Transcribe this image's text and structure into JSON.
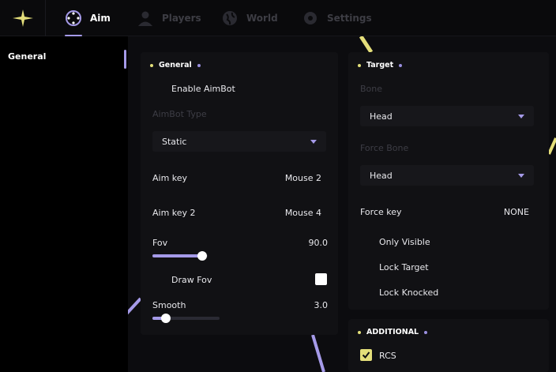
{
  "colors": {
    "accent": "#a59ae8",
    "accent_yellow": "#e4de7a",
    "background": "#0c0c0f",
    "panel": "#111114"
  },
  "nav": {
    "logo_icon": "star-logo-icon",
    "tabs": [
      {
        "label": "Aim",
        "icon": "crosshair-icon",
        "active": true
      },
      {
        "label": "Players",
        "icon": "person-icon",
        "active": false
      },
      {
        "label": "World",
        "icon": "globe-icon",
        "active": false
      },
      {
        "label": "Settings",
        "icon": "gear-icon",
        "active": false
      }
    ]
  },
  "sidebar": {
    "items": [
      {
        "label": "General",
        "active": true
      }
    ]
  },
  "general": {
    "title": "General",
    "enable_aimbot": {
      "label": "Enable AimBot",
      "checked": false
    },
    "aimbot_type": {
      "label": "AimBot Type",
      "value": "Static"
    },
    "aim_key": {
      "label": "Aim key",
      "value": "Mouse 2"
    },
    "aim_key2": {
      "label": "Aim key 2",
      "value": "Mouse 4"
    },
    "fov": {
      "label": "Fov",
      "value": "90.0",
      "fraction": 0.9
    },
    "draw_fov": {
      "label": "Draw Fov",
      "checked": true
    },
    "smooth": {
      "label": "Smooth",
      "value": "3.0",
      "fraction": 0.2
    }
  },
  "target": {
    "title": "Target",
    "bone": {
      "label": "Bone",
      "value": "Head"
    },
    "force_bone": {
      "label": "Force Bone",
      "value": "Head"
    },
    "force_key": {
      "label": "Force key",
      "value": "NONE"
    },
    "only_visible": {
      "label": "Only Visible",
      "checked": false
    },
    "lock_target": {
      "label": "Lock Target",
      "checked": false
    },
    "lock_knocked": {
      "label": "Lock Knocked",
      "checked": false
    }
  },
  "additional": {
    "title": "ADDITIONAL",
    "rcs": {
      "label": "RCS",
      "checked": true
    }
  }
}
